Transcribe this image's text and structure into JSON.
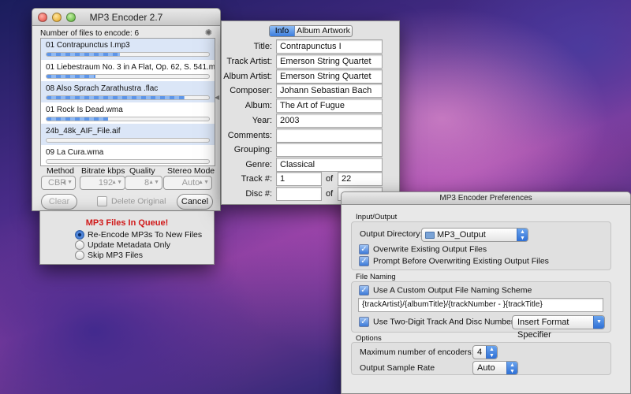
{
  "encoder": {
    "title": "MP3 Encoder 2.7",
    "files_count_label": "Number of files to encode: 6",
    "files": [
      {
        "name": "01 Contrapunctus I.mp3",
        "progress": 0.45
      },
      {
        "name": "01 Liebestraum No. 3 in A Flat, Op. 62, S. 541.m4a",
        "progress": 0.3
      },
      {
        "name": "08 Also Sprach Zarathustra .flac",
        "progress": 0.85
      },
      {
        "name": "01 Rock Is Dead.wma",
        "progress": 0.38
      },
      {
        "name": "24b_48k_AIF_File.aif",
        "progress": 0
      },
      {
        "name": "09 La Cura.wma",
        "progress": 0
      }
    ],
    "headers": {
      "method": "Method",
      "bitrate": "Bitrate kbps",
      "quality": "Quality",
      "stereo": "Stereo Mode"
    },
    "values": {
      "method": "CBR",
      "bitrate": "192",
      "quality": "8",
      "stereo": "Auto"
    },
    "clear_label": "Clear",
    "delete_original_label": "Delete Original",
    "cancel_label": "Cancel",
    "queue_title": "MP3 Files In Queue!",
    "queue_options": [
      "Re-Encode MP3s To New Files",
      "Update Metadata Only",
      "Skip MP3 Files"
    ]
  },
  "info": {
    "tabs": [
      "Info",
      "Album Artwork"
    ],
    "fields": [
      {
        "label": "Title:",
        "value": "Contrapunctus I"
      },
      {
        "label": "Track Artist:",
        "value": "Emerson String Quartet"
      },
      {
        "label": "Album Artist:",
        "value": "Emerson String Quartet"
      },
      {
        "label": "Composer:",
        "value": "Johann Sebastian Bach"
      },
      {
        "label": "Album:",
        "value": "The Art of Fugue"
      },
      {
        "label": "Year:",
        "value": "2003"
      },
      {
        "label": "Comments:",
        "value": ""
      },
      {
        "label": "Grouping:",
        "value": ""
      },
      {
        "label": "Genre:",
        "value": "Classical"
      }
    ],
    "track_label": "Track #:",
    "track_value": "1",
    "track_total": "22",
    "disc_label": "Disc #:",
    "disc_value": "",
    "disc_total": "",
    "of_label": "of"
  },
  "prefs": {
    "title": "MP3 Encoder Preferences",
    "io_section": "Input/Output",
    "output_dir_label": "Output Directory:",
    "output_dir_value": "MP3_Output",
    "overwrite_label": "Overwrite Existing Output Files",
    "prompt_label": "Prompt Before Overwriting Existing Output Files",
    "naming_section": "File Naming",
    "custom_scheme_label": "Use A Custom Output File Naming Scheme",
    "scheme_value": "{trackArtist}/{albumTitle}/{trackNumber - }{trackTitle}",
    "two_digit_label": "Use Two-Digit Track And Disc Numbers",
    "insert_label": "Insert Format Specifier",
    "options_section": "Options",
    "max_encoders_label": "Maximum number of encoders:",
    "max_encoders_value": "4",
    "sample_rate_label": "Output Sample Rate",
    "sample_rate_value": "Auto"
  }
}
